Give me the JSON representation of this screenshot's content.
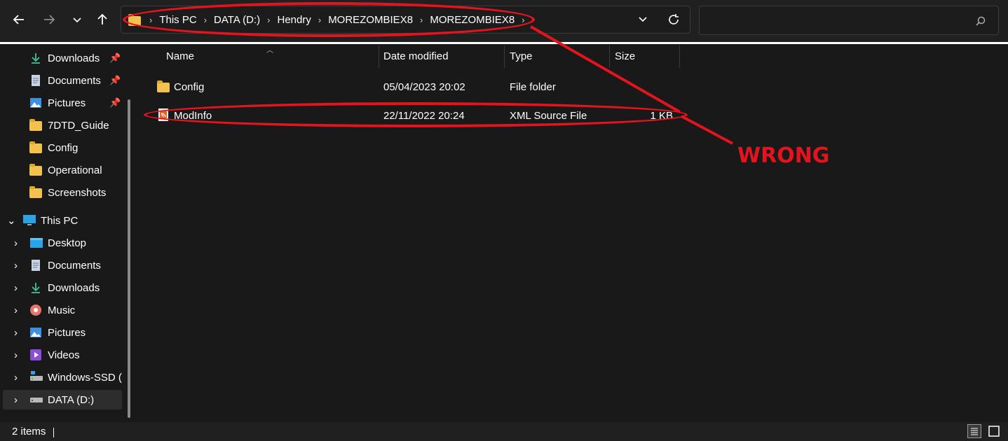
{
  "toolbar": {
    "back_icon": "arrow-left-icon",
    "forward_icon": "arrow-right-icon",
    "recent_icon": "chevron-down-icon",
    "up_icon": "arrow-up-icon",
    "breadcrumb": [
      "This PC",
      "DATA (D:)",
      "Hendry",
      "MOREZOMBIEX8",
      "MOREZOMBIEX8"
    ],
    "refresh_icon": "refresh-icon",
    "search_placeholder": ""
  },
  "sidebar": {
    "quick_access": [
      {
        "label": "Downloads",
        "icon": "download-icon",
        "pinned": true
      },
      {
        "label": "Documents",
        "icon": "document-icon",
        "pinned": true
      },
      {
        "label": "Pictures",
        "icon": "picture-icon",
        "pinned": true
      },
      {
        "label": "7DTD_Guide",
        "icon": "folder-icon",
        "pinned": false
      },
      {
        "label": "Config",
        "icon": "folder-icon",
        "pinned": false
      },
      {
        "label": "Operational",
        "icon": "folder-icon",
        "pinned": false
      },
      {
        "label": "Screenshots",
        "icon": "folder-icon",
        "pinned": false
      }
    ],
    "this_pc_label": "This PC",
    "this_pc_items": [
      {
        "label": "Desktop",
        "icon": "desktop-icon"
      },
      {
        "label": "Documents",
        "icon": "document-icon"
      },
      {
        "label": "Downloads",
        "icon": "download-icon"
      },
      {
        "label": "Music",
        "icon": "music-icon"
      },
      {
        "label": "Pictures",
        "icon": "picture-icon"
      },
      {
        "label": "Videos",
        "icon": "video-icon"
      },
      {
        "label": "Windows-SSD (C",
        "icon": "drive-icon"
      },
      {
        "label": "DATA (D:)",
        "icon": "drive-icon"
      }
    ]
  },
  "columns": {
    "name": "Name",
    "date": "Date modified",
    "type": "Type",
    "size": "Size"
  },
  "files": [
    {
      "name": "Config",
      "date": "05/04/2023 20:02",
      "type": "File folder",
      "size": "",
      "icon": "folder-icon"
    },
    {
      "name": "ModInfo",
      "date": "22/11/2022 20:24",
      "type": "XML Source File",
      "size": "1 KB",
      "icon": "xml-file-icon"
    }
  ],
  "status": {
    "items": "2 items"
  },
  "annotation": {
    "label": "WRONG",
    "color": "#e3141e"
  }
}
